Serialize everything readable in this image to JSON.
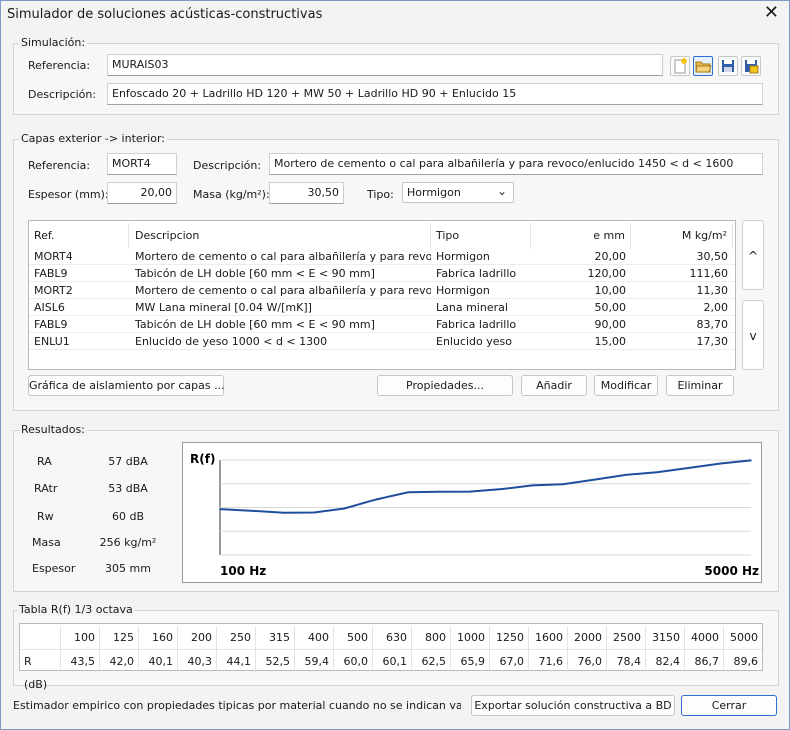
{
  "window": {
    "title": "Simulador de soluciones acústicas-constructivas"
  },
  "simulacion": {
    "group_label": "Simulación:",
    "referencia_label": "Referencia:",
    "referencia_value": "MURAIS03",
    "descripcion_label": "Descripción:",
    "descripcion_value": "Enfoscado 20 + Ladrillo HD 120 + MW 50 + Ladrillo HD 90 + Enlucido 15",
    "toolbar": [
      "new-file-icon",
      "open-folder-icon",
      "save-icon",
      "save-as-icon"
    ]
  },
  "capas": {
    "group_label": "Capas exterior -> interior:",
    "referencia_label": "Referencia:",
    "referencia_value": "MORT4",
    "descripcion_label": "Descripción:",
    "descripcion_value": "Mortero de cemento o cal para albañilería y para revoco/enlucido 1450 < d < 1600",
    "espesor_label": "Espesor (mm):",
    "espesor_value": "20,00",
    "masa_label": "Masa (kg/m²):",
    "masa_value": "30,50",
    "tipo_label": "Tipo:",
    "tipo_value": "Hormigon",
    "columns": [
      "Ref.",
      "Descripcion",
      "Tipo",
      "e mm",
      "M kg/m²"
    ],
    "rows": [
      [
        "MORT4",
        "Mortero de cemento o cal para albañilería y para revoco/...",
        "Hormigon",
        "20,00",
        "30,50"
      ],
      [
        "FABL9",
        "Tabicón de LH doble [60 mm < E < 90 mm]",
        "Fabrica ladrillo",
        "120,00",
        "111,60"
      ],
      [
        "MORT2",
        "Mortero de cemento o cal para albañilería y para revoco/...",
        "Hormigon",
        "10,00",
        "11,30"
      ],
      [
        "AISL6",
        "MW Lana mineral [0.04 W/[mK]]",
        "Lana mineral",
        "50,00",
        "2,00"
      ],
      [
        "FABL9",
        "Tabicón de LH doble [60 mm < E < 90 mm]",
        "Fabrica ladrillo",
        "90,00",
        "83,70"
      ],
      [
        "ENLU1",
        "Enlucido de yeso 1000 < d < 1300",
        "Enlucido yeso",
        "15,00",
        "17,30"
      ]
    ],
    "up_label": "^",
    "down_label": "v",
    "grafica_button": "Gráfica de aislamiento por capas ...",
    "propiedades_button": "Propiedades...",
    "anadir_button": "Añadir",
    "modificar_button": "Modificar",
    "eliminar_button": "Eliminar"
  },
  "resultados": {
    "group_label": "Resultados:",
    "items": [
      {
        "label": "RA",
        "value": "57 dBA"
      },
      {
        "label": "RAtr",
        "value": "53 dBA"
      },
      {
        "label": "Rw",
        "value": "60 dB"
      },
      {
        "label": "Masa",
        "value": "256 kg/m²"
      },
      {
        "label": "Espesor",
        "value": "305 mm"
      }
    ]
  },
  "chart_data": {
    "type": "line",
    "title": "R(f)",
    "xlabel_left": "100 Hz",
    "xlabel_right": "5000 Hz",
    "x": [
      100,
      125,
      160,
      200,
      250,
      315,
      400,
      500,
      630,
      800,
      1000,
      1250,
      1600,
      2000,
      2500,
      3150,
      4000,
      5000
    ],
    "series": [
      {
        "values": [
          43.5,
          42.0,
          40.1,
          40.3,
          44.1,
          52.5,
          59.4,
          60.0,
          60.1,
          62.5,
          65.9,
          67.0,
          71.6,
          76.0,
          78.4,
          82.4,
          86.7,
          89.6
        ]
      }
    ],
    "ylim": [
      0,
      90
    ],
    "grid": true,
    "color": "#1f4e9c"
  },
  "tabla": {
    "group_label": "Tabla R(f) 1/3 octava",
    "row_label": "R (dB)",
    "freqs": [
      "100",
      "125",
      "160",
      "200",
      "250",
      "315",
      "400",
      "500",
      "630",
      "800",
      "1000",
      "1250",
      "1600",
      "2000",
      "2500",
      "3150",
      "4000",
      "5000"
    ],
    "values": [
      "43,5",
      "42,0",
      "40,1",
      "40,3",
      "44,1",
      "52,5",
      "59,4",
      "60,0",
      "60,1",
      "62,5",
      "65,9",
      "67,0",
      "71,6",
      "76,0",
      "78,4",
      "82,4",
      "86,7",
      "89,6"
    ]
  },
  "footer": {
    "status_text": "Estimador empirico con propiedades tipicas por material cuando no se indican valores especificos",
    "exportar_button": "Exportar solución constructiva a BD",
    "cerrar_button": "Cerrar"
  }
}
